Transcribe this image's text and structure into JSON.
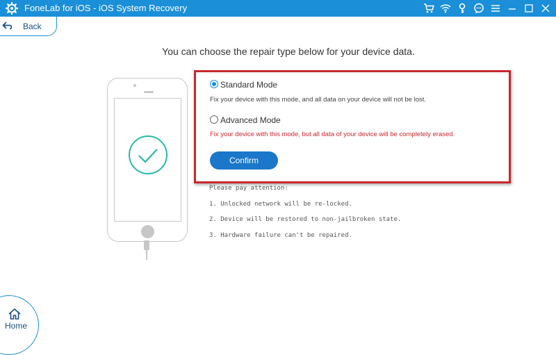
{
  "titlebar": {
    "title": "FoneLab for iOS - iOS System Recovery",
    "bg_color": "#1b8fd8",
    "icons": [
      "cart-icon",
      "wifi-icon",
      "key-icon",
      "chat-icon",
      "menu-icon",
      "minimize-icon",
      "maximize-icon",
      "close-icon"
    ]
  },
  "nav": {
    "back_label": "Back",
    "home_label": "Home"
  },
  "main": {
    "headline": "You can choose the repair type below for your device data.",
    "standard": {
      "label": "Standard Mode",
      "description": "Fix your device with this mode, and all data on your device will not be lost.",
      "selected": true
    },
    "advanced": {
      "label": "Advanced Mode",
      "description": "Fix your device with this mode, but all data of your device will be completely erased.",
      "selected": false
    },
    "confirm_label": "Confirm",
    "highlight_color": "#c8282e",
    "notes": {
      "heading": "Please pay attention:",
      "items": [
        "1. Unlocked network will be re-locked.",
        "2. Device will be restored to non-jailbroken state.",
        "3. Hardware failure can't be repaired."
      ]
    }
  }
}
